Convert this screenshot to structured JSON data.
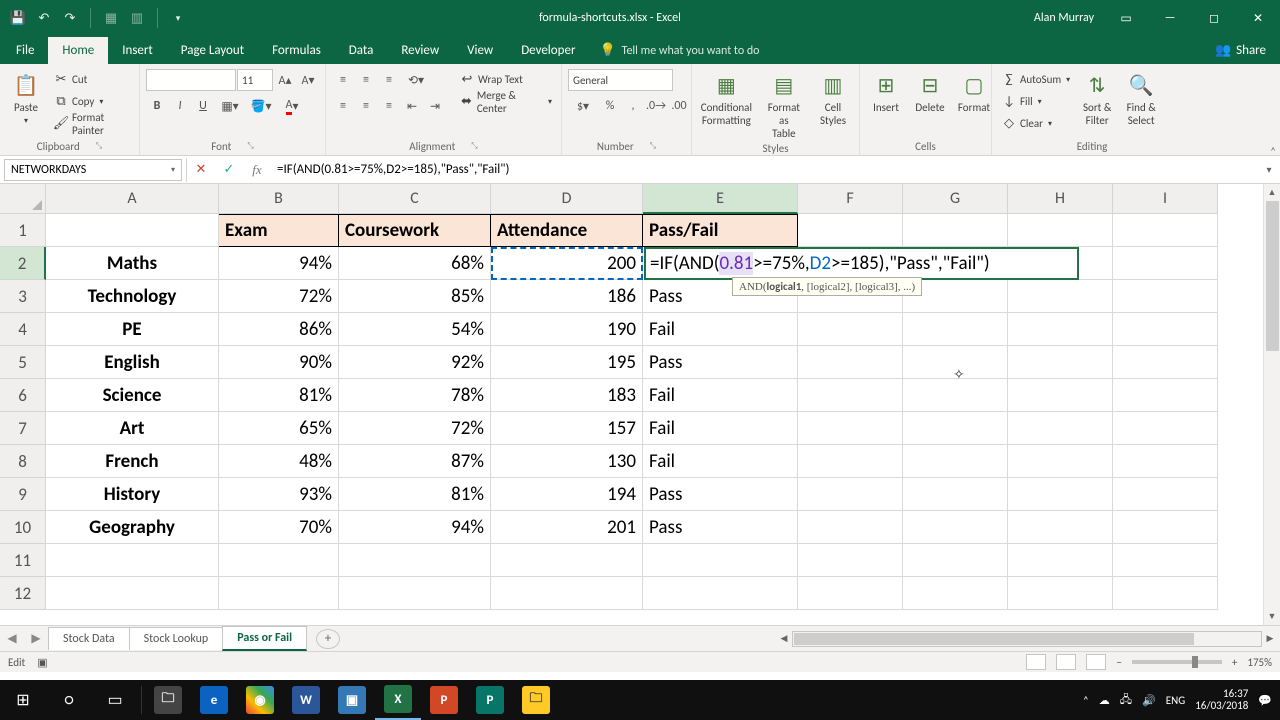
{
  "titlebar": {
    "filename": "formula-shortcuts.xlsx - Excel",
    "user": "Alan Murray"
  },
  "tabs": {
    "file": "File",
    "home": "Home",
    "insert": "Insert",
    "pagelayout": "Page Layout",
    "formulas": "Formulas",
    "data": "Data",
    "review": "Review",
    "view": "View",
    "developer": "Developer",
    "tellme": "Tell me what you want to do",
    "share": "Share"
  },
  "ribbon": {
    "clipboard": {
      "label": "Clipboard",
      "paste": "Paste",
      "cut": "Cut",
      "copy": "Copy",
      "format_painter": "Format Painter"
    },
    "font": {
      "label": "Font",
      "size": "11"
    },
    "alignment": {
      "label": "Alignment",
      "wrap": "Wrap Text",
      "merge": "Merge & Center"
    },
    "number": {
      "label": "Number",
      "format": "General"
    },
    "styles": {
      "label": "Styles",
      "cf": "Conditional\nFormatting",
      "fat": "Format as\nTable",
      "cs": "Cell\nStyles"
    },
    "cells": {
      "label": "Cells",
      "insert": "Insert",
      "delete": "Delete",
      "format": "Format"
    },
    "editing": {
      "label": "Editing",
      "autosum": "AutoSum",
      "fill": "Fill",
      "clear": "Clear",
      "sort": "Sort &\nFilter",
      "find": "Find &\nSelect"
    }
  },
  "namebox": "NETWORKDAYS",
  "formula": "=IF(AND(0.81>=75%,D2>=185),\"Pass\",\"Fail\")",
  "tooltip": "AND(logical1, [logical2], [logical3], ...)",
  "cell_formula": {
    "pre": "=IF(AND(",
    "p1": "0.81",
    "mid1": ">=75%,",
    "ref": "D2",
    "mid2": ">=185)",
    "post": ",\"Pass\",\"Fail\")"
  },
  "columns": [
    "A",
    "B",
    "C",
    "D",
    "E",
    "F",
    "G",
    "H",
    "I"
  ],
  "headers": {
    "b": "Exam",
    "c": "Coursework",
    "d": "Attendance",
    "e": "Pass/Fail"
  },
  "rows": [
    {
      "n": "2",
      "a": "Maths",
      "b": "94%",
      "c": "68%",
      "d": "200",
      "e": ""
    },
    {
      "n": "3",
      "a": "Technology",
      "b": "72%",
      "c": "85%",
      "d": "186",
      "e": "Pass"
    },
    {
      "n": "4",
      "a": "PE",
      "b": "86%",
      "c": "54%",
      "d": "190",
      "e": "Fail"
    },
    {
      "n": "5",
      "a": "English",
      "b": "90%",
      "c": "92%",
      "d": "195",
      "e": "Pass"
    },
    {
      "n": "6",
      "a": "Science",
      "b": "81%",
      "c": "78%",
      "d": "183",
      "e": "Fail"
    },
    {
      "n": "7",
      "a": "Art",
      "b": "65%",
      "c": "72%",
      "d": "157",
      "e": "Fail"
    },
    {
      "n": "8",
      "a": "French",
      "b": "48%",
      "c": "87%",
      "d": "130",
      "e": "Fail"
    },
    {
      "n": "9",
      "a": "History",
      "b": "93%",
      "c": "81%",
      "d": "194",
      "e": "Pass"
    },
    {
      "n": "10",
      "a": "Geography",
      "b": "70%",
      "c": "94%",
      "d": "201",
      "e": "Pass"
    }
  ],
  "blank_rows": [
    "11",
    "12"
  ],
  "sheets": {
    "s1": "Stock Data",
    "s2": "Stock Lookup",
    "s3": "Pass or Fail"
  },
  "status": {
    "mode": "Edit",
    "zoom": "175%"
  },
  "tray": {
    "lang": "ENG",
    "time": "16:37",
    "date": "16/03/2018"
  }
}
